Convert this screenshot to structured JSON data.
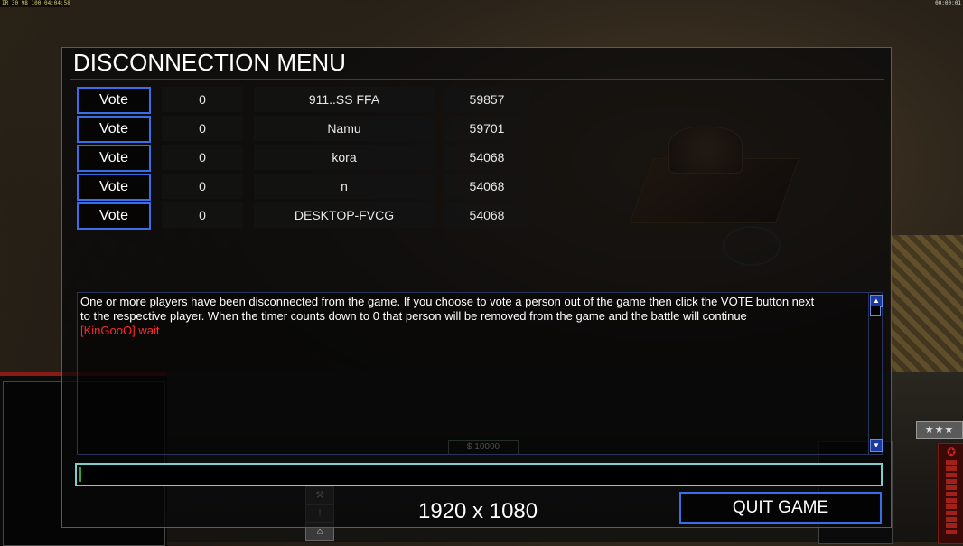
{
  "hud": {
    "stats": "IR 30 98 100 04:04:58",
    "clock": "00:00:01"
  },
  "dialog": {
    "title": "DISCONNECTION MENU",
    "players": [
      {
        "vote_label": "Vote",
        "count": "0",
        "name": "911..SS FFA",
        "ping": "59857"
      },
      {
        "vote_label": "Vote",
        "count": "0",
        "name": "Namu",
        "ping": "59701"
      },
      {
        "vote_label": "Vote",
        "count": "0",
        "name": "kora",
        "ping": "54068"
      },
      {
        "vote_label": "Vote",
        "count": "0",
        "name": "n",
        "ping": "54068"
      },
      {
        "vote_label": "Vote",
        "count": "0",
        "name": "DESKTOP-FVCG",
        "ping": "54068"
      }
    ],
    "chat": {
      "lines": [
        "One or more players have been disconnected from the game. If you choose to vote a person out of the game then click the VOTE button next",
        " to the respective player. When the timer counts down to 0 that person will be removed from the game and the battle will continue",
        "[KinGooO] wait"
      ]
    },
    "input_value": "",
    "quit_label": "QUIT GAME"
  },
  "background": {
    "money": "$ 10000",
    "rank": "★★★",
    "resolution_label": "1920 x 1080"
  },
  "colors": {
    "button_border": "#3a6ee8",
    "chat_alert": "#ff2a2a",
    "input_border": "#7ad0d0"
  }
}
